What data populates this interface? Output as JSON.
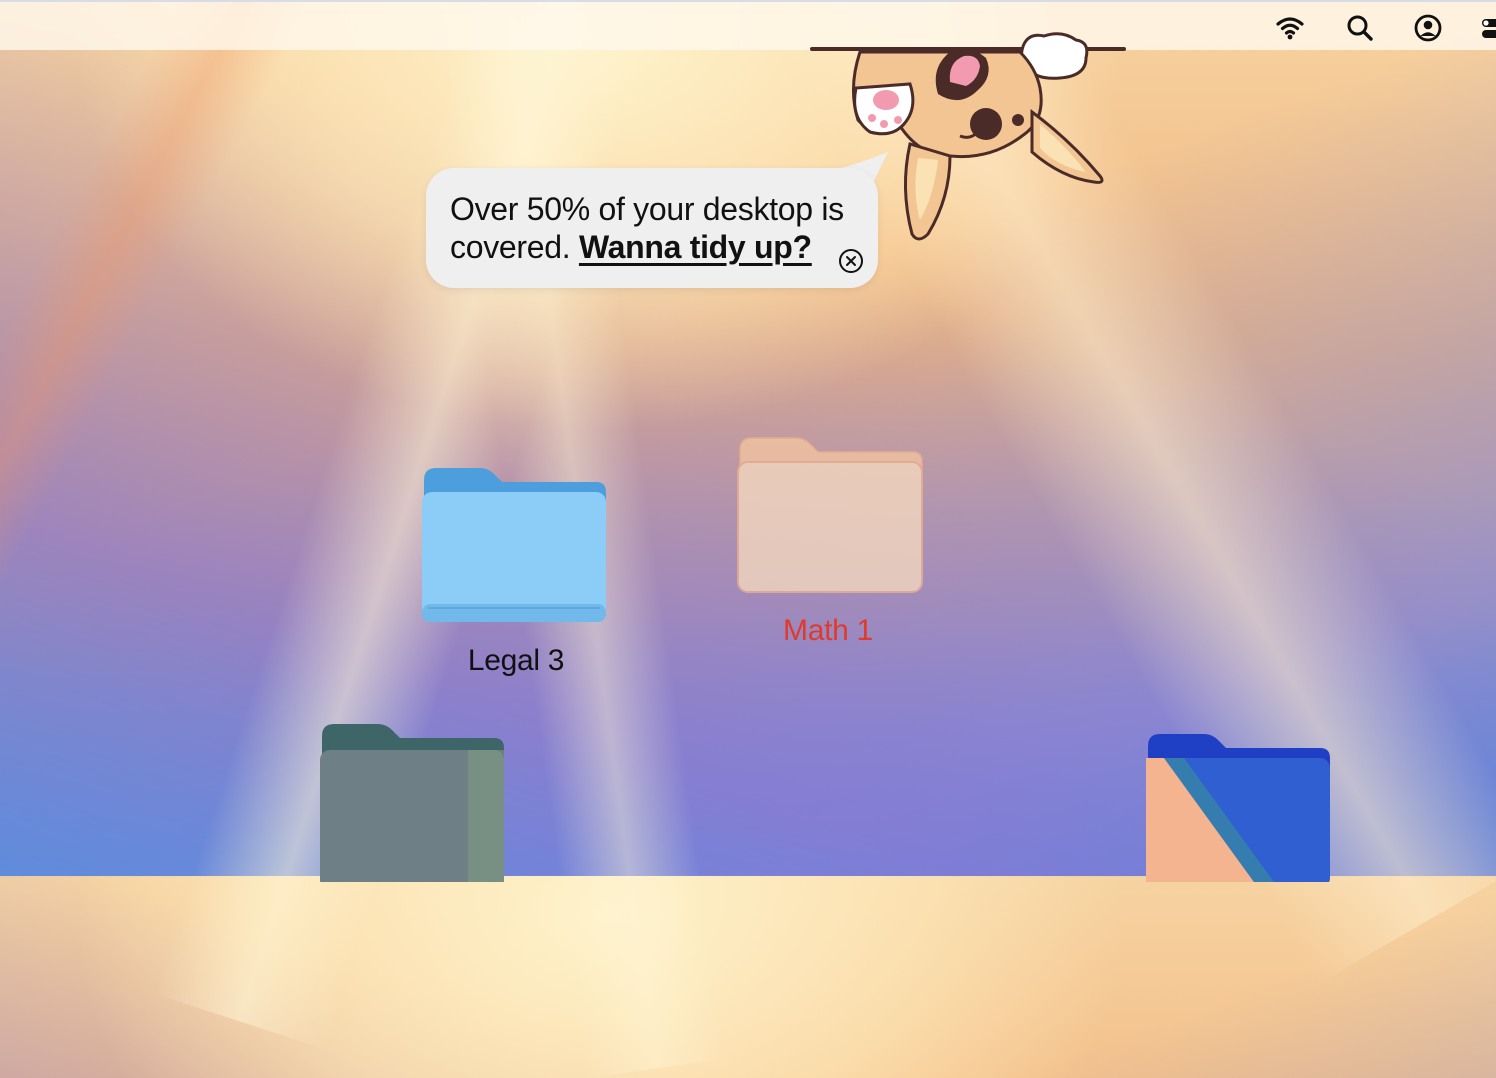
{
  "menubar": {
    "icons": [
      "wifi-icon",
      "search-icon",
      "user-account-icon",
      "control-center-icon"
    ]
  },
  "tidy_prompt": {
    "message": "Over 50% of your desktop is covered.",
    "action_label": "Wanna tidy up?",
    "close_icon": "close-circle-icon"
  },
  "mascot": {
    "icon": "corgi-mascot"
  },
  "desktop_items": [
    {
      "name": "Legal 3",
      "color": "#8ccdf7",
      "label_color": "#111111"
    },
    {
      "name": "Math 1",
      "color": "#f6d2aa",
      "label_color": "#e03a2a"
    },
    {
      "name": "",
      "color": "#6f7f86"
    },
    {
      "name": "",
      "color": "#2f5fd0"
    }
  ],
  "colors": {
    "bubble_bg": "#efefef",
    "text": "#111111",
    "selected_label": "#e03a2a"
  }
}
